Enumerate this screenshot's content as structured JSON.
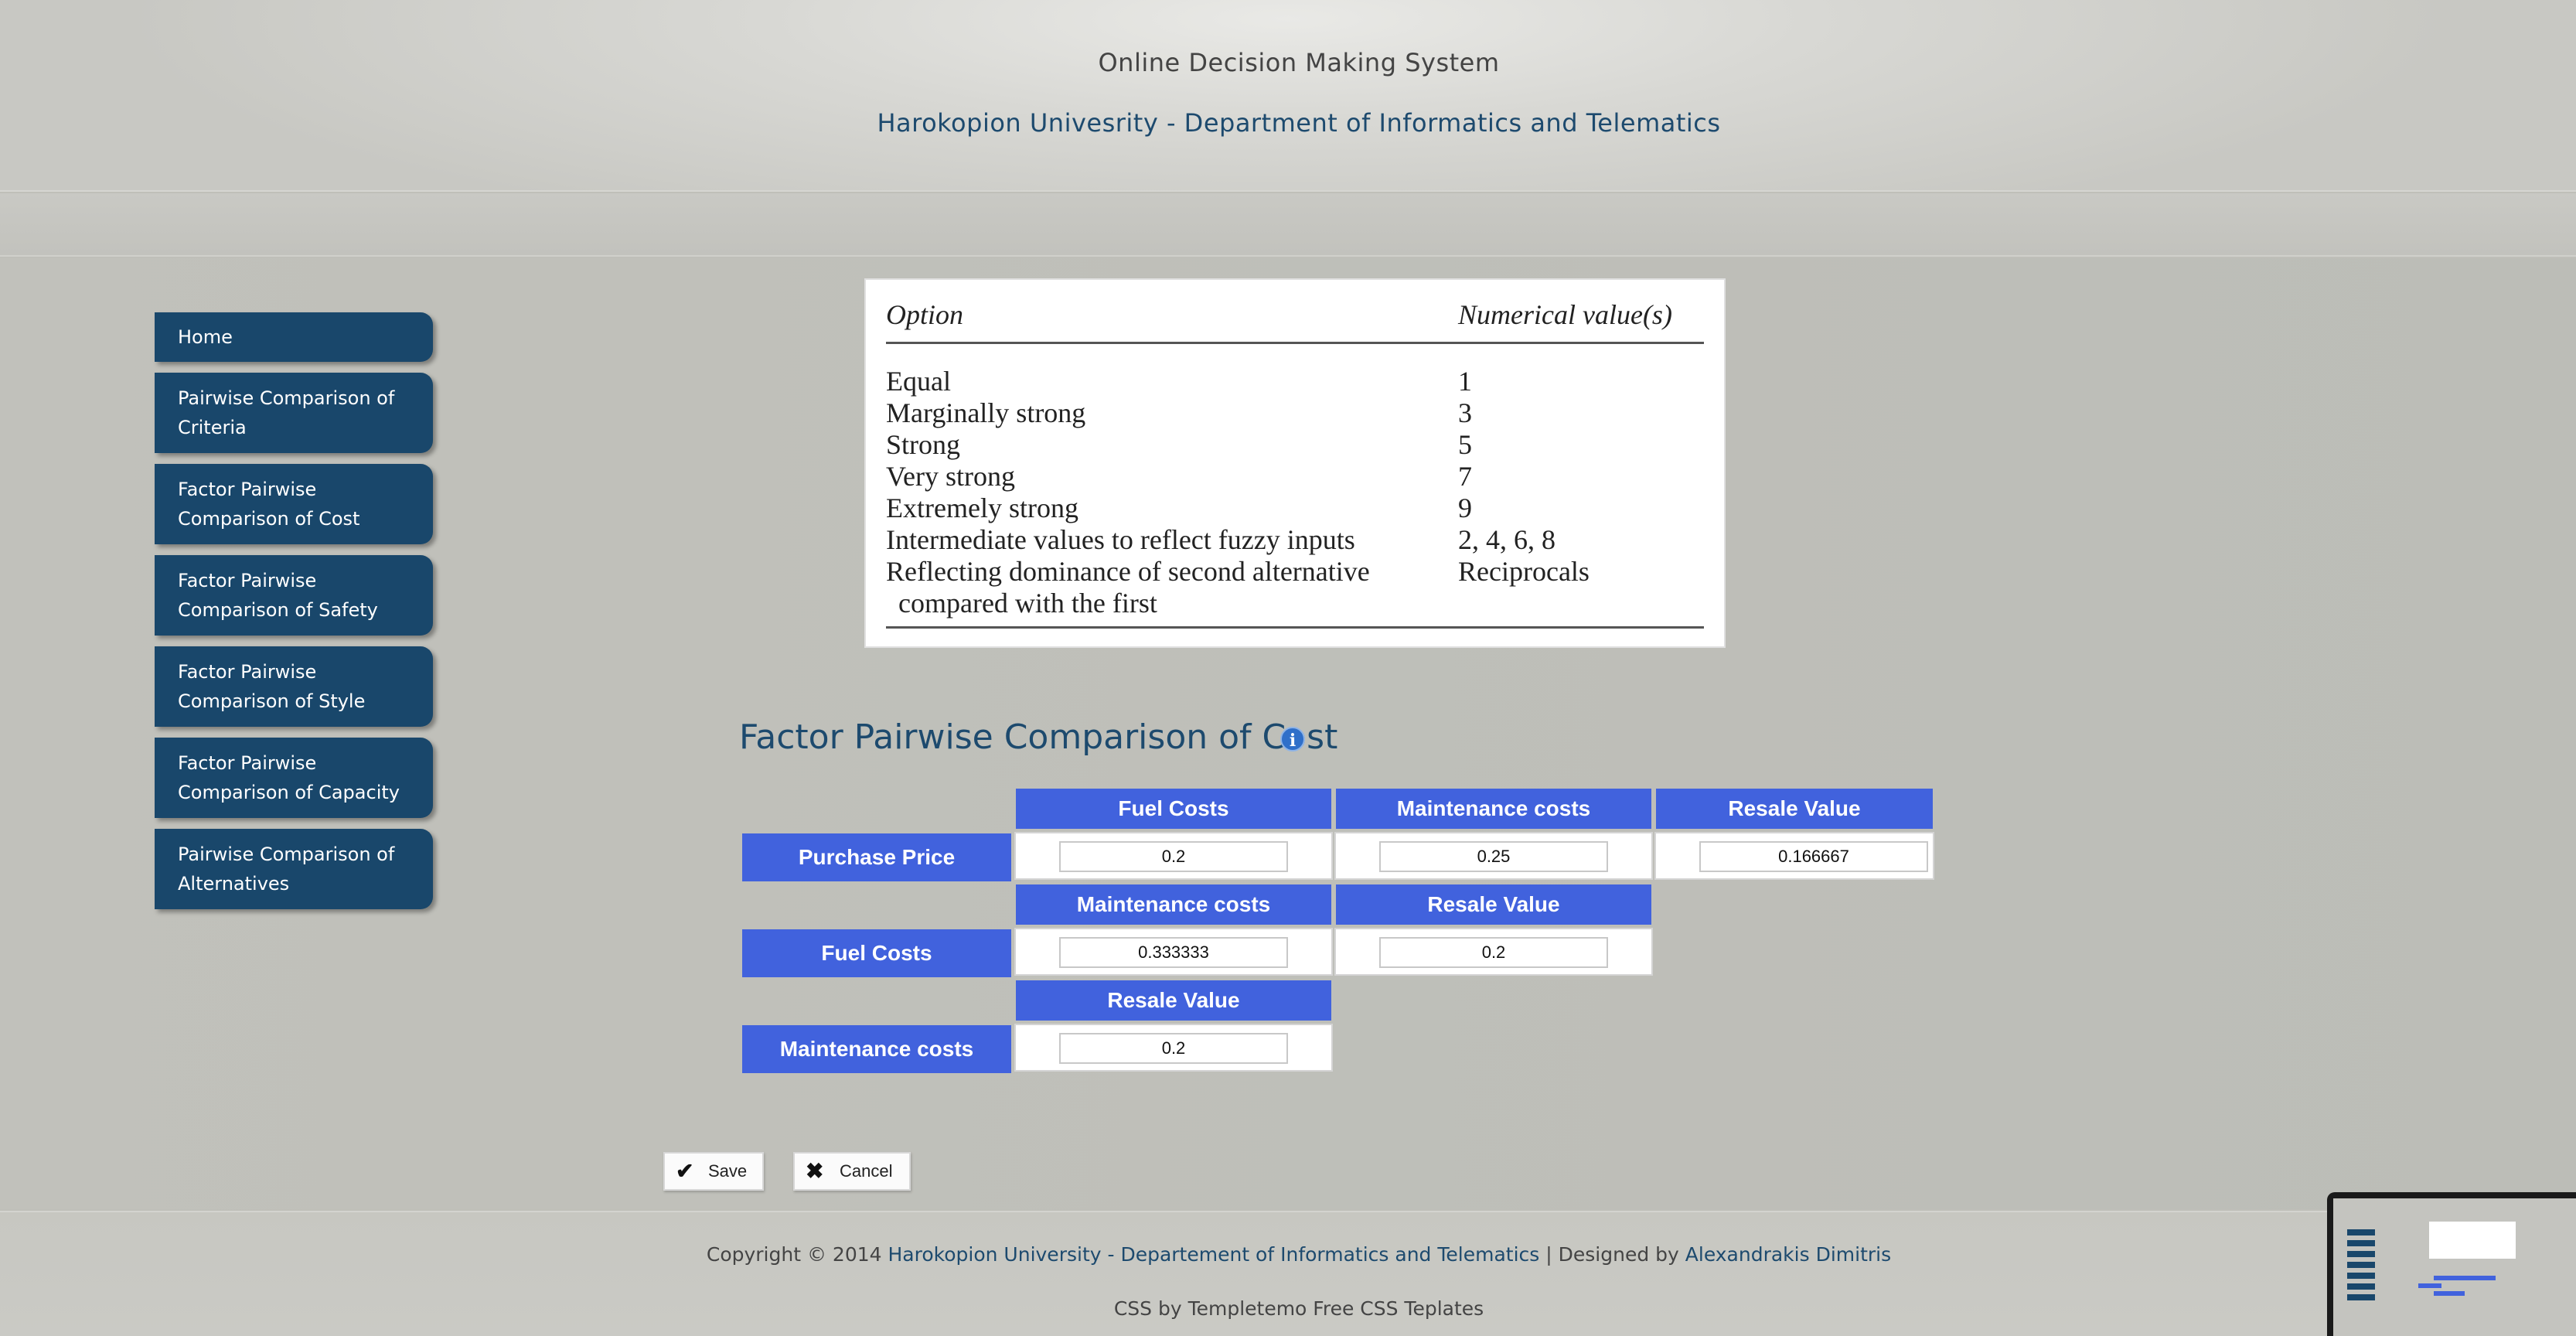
{
  "header": {
    "title": "Online Decision Making System",
    "subtitle": "Harokopion Univesrity - Department of Informatics and Telematics"
  },
  "sidebar": {
    "items": [
      {
        "label": "Home"
      },
      {
        "label_line1": "Pairwise Comparison of",
        "label_line2": "Criteria"
      },
      {
        "label_line1": "Factor Pairwise",
        "label_line2": "Comparison of Cost"
      },
      {
        "label_line1": "Factor Pairwise",
        "label_line2": "Comparison of Safety"
      },
      {
        "label_line1": "Factor Pairwise",
        "label_line2": "Comparison of Style"
      },
      {
        "label_line1": "Factor Pairwise",
        "label_line2": "Comparison of Capacity"
      },
      {
        "label_line1": "Pairwise Comparison of",
        "label_line2": "Alternatives"
      }
    ]
  },
  "scale_table": {
    "header_option": "Option",
    "header_value": "Numerical value(s)",
    "rows": [
      {
        "option": "Equal",
        "value": "1"
      },
      {
        "option": "Marginally strong",
        "value": "3"
      },
      {
        "option": "Strong",
        "value": "5"
      },
      {
        "option": "Very strong",
        "value": "7"
      },
      {
        "option": "Extremely strong",
        "value": "9"
      },
      {
        "option": "Intermediate values to reflect fuzzy inputs",
        "value": "2, 4, 6, 8"
      },
      {
        "option": "Reflecting dominance of second alternative",
        "option_cont": "compared with the first",
        "value": "Reciprocals"
      }
    ]
  },
  "section": {
    "title": "Factor Pairwise Comparison of Cost",
    "info_icon": "i"
  },
  "comparison": {
    "block1": {
      "row_label": "Purchase Price",
      "columns": [
        "Fuel Costs",
        "Maintenance costs",
        "Resale Value"
      ],
      "values": [
        "0.2",
        "0.25",
        "0.166667"
      ]
    },
    "block2": {
      "row_label": "Fuel Costs",
      "columns": [
        "Maintenance costs",
        "Resale Value"
      ],
      "values": [
        "0.333333",
        "0.2"
      ]
    },
    "block3": {
      "row_label": "Maintenance costs",
      "columns": [
        "Resale Value"
      ],
      "values": [
        "0.2"
      ]
    }
  },
  "buttons": {
    "save": "Save",
    "cancel": "Cancel"
  },
  "footer": {
    "copyright_prefix": "Copyright © 2014",
    "university_link": "Harokopion University - Departement of Informatics and Telematics",
    "designed_by_prefix": "| Designed by",
    "designer_link": "Alexandrakis Dimitris",
    "credit": "CSS by Templetemo Free CSS Teplates"
  },
  "colors": {
    "nav": "#19476b",
    "grid_header": "#4162dd",
    "heading": "#1d4a6e"
  }
}
